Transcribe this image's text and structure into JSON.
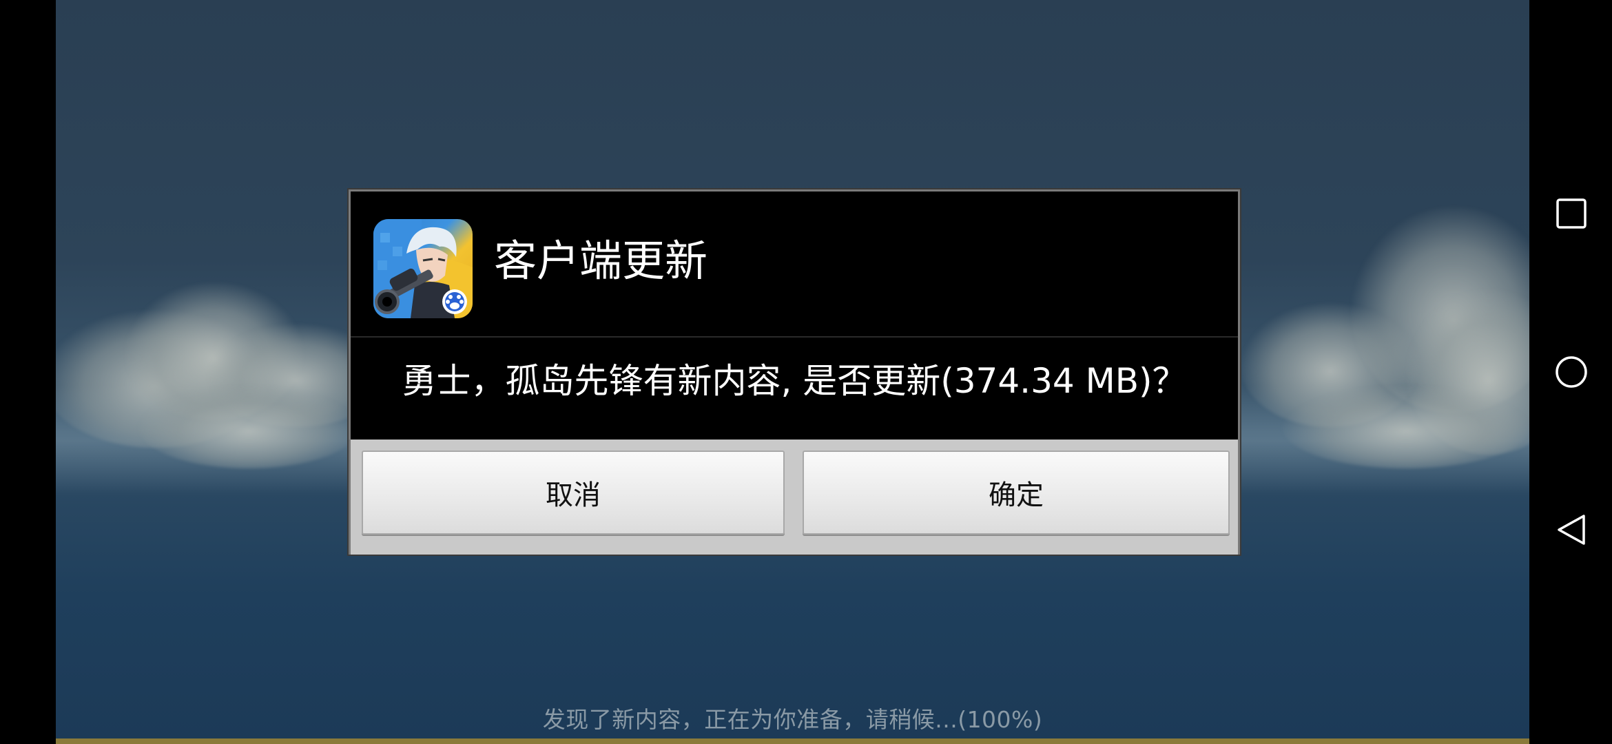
{
  "dialog": {
    "title": "客户端更新",
    "message": "勇士，孤岛先锋有新内容, 是否更新(374.34 MB)？",
    "cancel_label": "取消",
    "ok_label": "确定",
    "icon": "game-app-icon"
  },
  "game": {
    "loading_text": "发现了新内容，正在为你准备，请稍候...(100%)",
    "loading_progress": 1.0
  },
  "navbar": {
    "recents_icon": "square-icon",
    "home_icon": "circle-icon",
    "back_icon": "triangle-back-icon"
  },
  "colors": {
    "dialog_bg": "#000000",
    "button_bar_bg": "#c9c9c9",
    "loading_text": "#8a9aa6",
    "loading_bar": "#8a7a3a"
  }
}
